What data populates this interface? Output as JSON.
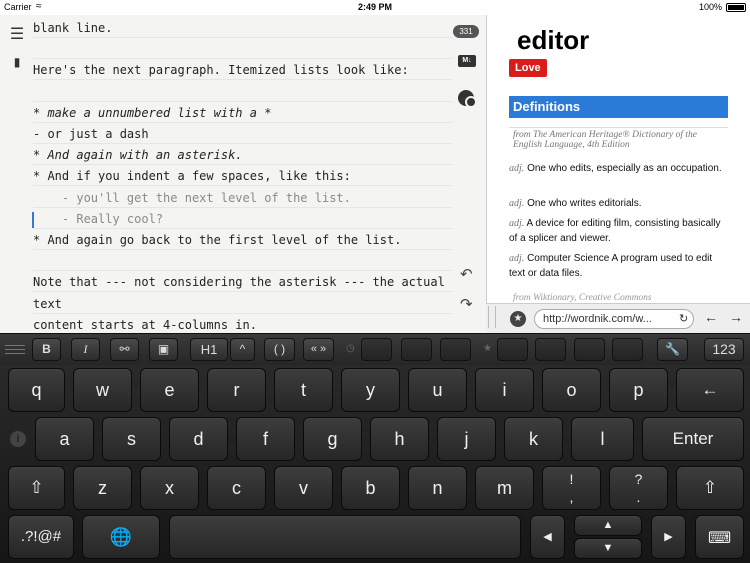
{
  "status": {
    "carrier": "Carrier",
    "time": "2:49 PM",
    "battery": "100%"
  },
  "editor": {
    "lines": [
      {
        "text": "blank line.",
        "style": ""
      },
      {
        "text": "",
        "style": ""
      },
      {
        "text": "Here's the next paragraph. Itemized lists look like:",
        "style": ""
      },
      {
        "text": "",
        "style": ""
      },
      {
        "text": "* make a unnumbered list with a *",
        "style": "ital"
      },
      {
        "text": "- or just a dash",
        "style": ""
      },
      {
        "text": "* And again with an asterisk.",
        "style": "ital"
      },
      {
        "text": "* And if you indent a few spaces, like this:",
        "style": ""
      },
      {
        "text": "    - you'll get the next level of the list.",
        "style": "dim"
      },
      {
        "text": "    - Really cool?",
        "style": "dim"
      },
      {
        "text": "* And again go back to the first level of the list.",
        "style": ""
      },
      {
        "text": "",
        "style": ""
      },
      {
        "text": "Note that --- not considering the asterisk --- the actual",
        "style": ""
      },
      {
        "text": "text",
        "style": ""
      },
      {
        "text": "content starts at 4-columns in.",
        "style": ""
      }
    ],
    "word_count": "331",
    "md_label": "M↓"
  },
  "dictionary": {
    "word": "editor",
    "love_label": "Love",
    "definitions_heading": "Definitions",
    "source": "from The American Heritage® Dictionary of the English Language, 4th Edition",
    "definitions": [
      {
        "pos": "adj.",
        "text": "One who edits, especially as an occupation."
      },
      {
        "pos": "adj.",
        "text": "One who writes editorials."
      },
      {
        "pos": "adj.",
        "text": "A device for editing film, consisting basically of a splicer and viewer."
      },
      {
        "pos": "adj.",
        "text": "Computer Science A program used to edit text or data files."
      }
    ],
    "source2": "from Wiktionary, Creative Commons",
    "url": "http://wordnik.com/w..."
  },
  "accessory": {
    "bold": "B",
    "italic": "I",
    "heading": "H1",
    "caret_up": "^",
    "parens": "( )",
    "quotes": "« »",
    "numbers": "123"
  },
  "keyboard": {
    "row1": [
      "q",
      "w",
      "e",
      "r",
      "t",
      "y",
      "u",
      "i",
      "o",
      "p"
    ],
    "backspace": "←",
    "row2": [
      "a",
      "s",
      "d",
      "f",
      "g",
      "h",
      "j",
      "k",
      "l"
    ],
    "enter": "Enter",
    "row3": [
      "z",
      "x",
      "c",
      "v",
      "b",
      "n",
      "m"
    ],
    "punct1": [
      "!",
      ","
    ],
    "punct2": [
      "?",
      "."
    ],
    "shift": "⇧",
    "symbols": ".?!@#",
    "arrows": {
      "left": "◀",
      "up": "▲",
      "down": "▼",
      "right": "▶"
    }
  }
}
